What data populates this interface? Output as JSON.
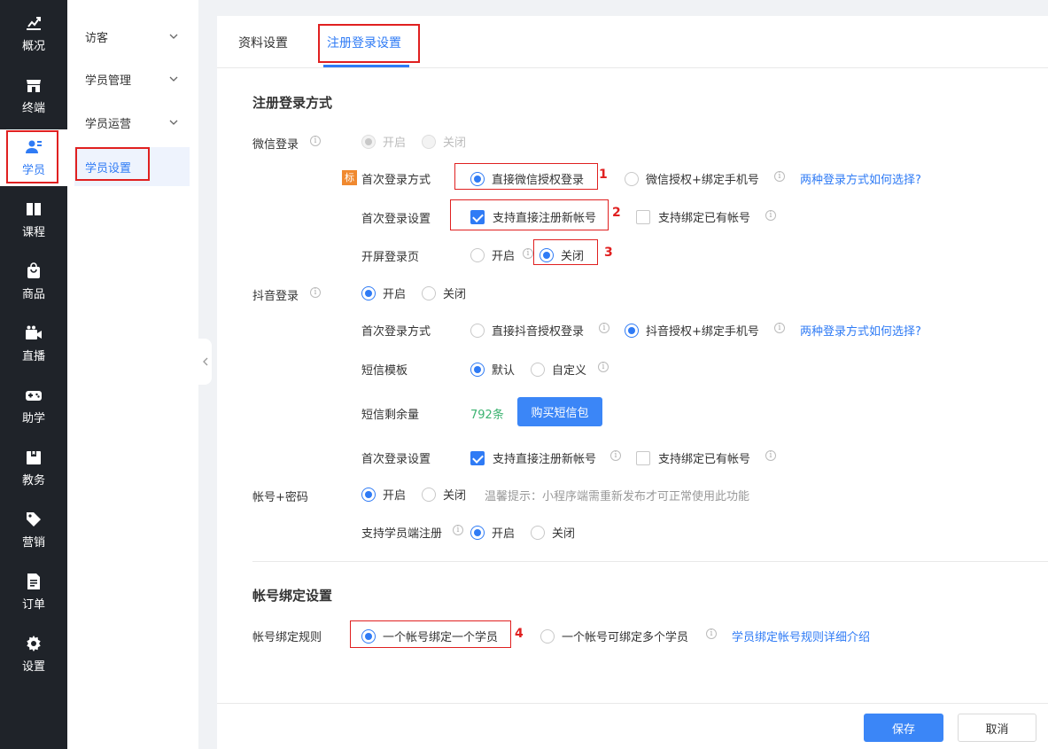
{
  "sidebar": {
    "items": [
      {
        "label": "概况",
        "icon": "chart-icon"
      },
      {
        "label": "终端",
        "icon": "store-icon"
      },
      {
        "label": "学员",
        "icon": "users-icon"
      },
      {
        "label": "课程",
        "icon": "book-icon"
      },
      {
        "label": "商品",
        "icon": "bag-icon"
      },
      {
        "label": "直播",
        "icon": "video-icon"
      },
      {
        "label": "助学",
        "icon": "gamepad-icon"
      },
      {
        "label": "教务",
        "icon": "calendar-icon"
      },
      {
        "label": "营销",
        "icon": "tag-icon"
      },
      {
        "label": "订单",
        "icon": "document-icon"
      },
      {
        "label": "设置",
        "icon": "gear-icon"
      }
    ],
    "active_color": "#2f7bf5"
  },
  "subnav": {
    "items": [
      {
        "label": "访客"
      },
      {
        "label": "学员管理"
      },
      {
        "label": "学员运营"
      },
      {
        "label": "学员设置"
      }
    ]
  },
  "tabs": [
    {
      "label": "资料设置"
    },
    {
      "label": "注册登录设置"
    }
  ],
  "login": {
    "section_title": "注册登录方式",
    "wechat": {
      "label": "微信登录",
      "open": "开启",
      "close": "关闭",
      "badge": "标",
      "first_method_label": "首次登录方式",
      "first_method_opt1": "直接微信授权登录",
      "first_method_opt2": "微信授权+绑定手机号",
      "first_method_link": "两种登录方式如何选择?",
      "first_setting_label": "首次登录设置",
      "first_setting_opt1": "支持直接注册新帐号",
      "first_setting_opt2": "支持绑定已有帐号",
      "splash_label": "开屏登录页",
      "splash_open": "开启",
      "splash_close": "关闭"
    },
    "douyin": {
      "label": "抖音登录",
      "open": "开启",
      "close": "关闭",
      "first_method_label": "首次登录方式",
      "first_method_opt1": "直接抖音授权登录",
      "first_method_opt2": "抖音授权+绑定手机号",
      "first_method_link": "两种登录方式如何选择?",
      "sms_template_label": "短信模板",
      "sms_template_default": "默认",
      "sms_template_custom": "自定义",
      "sms_remaining_label": "短信剩余量",
      "sms_remaining_value": "792条",
      "buy_sms_button": "购买短信包",
      "first_setting_label": "首次登录设置",
      "first_setting_opt1": "支持直接注册新帐号",
      "first_setting_opt2": "支持绑定已有帐号"
    },
    "account": {
      "label": "帐号+密码",
      "open": "开启",
      "close": "关闭",
      "hint": "温馨提示：小程序端需重新发布才可正常使用此功能",
      "student_register_label": "支持学员端注册",
      "student_register_open": "开启",
      "student_register_close": "关闭"
    }
  },
  "binding": {
    "section_title": "帐号绑定设置",
    "rule_label": "帐号绑定规则",
    "opt1": "一个帐号绑定一个学员",
    "opt2": "一个帐号可绑定多个学员",
    "link": "学员绑定帐号规则详细介绍"
  },
  "annotations": [
    "1",
    "2",
    "3",
    "4"
  ],
  "footer": {
    "save_button": "保存",
    "cancel_button": "取消"
  },
  "colors": {
    "primary": "#2f7bf5",
    "highlight": "#e02020",
    "sidebar_bg": "#1f2329",
    "badge": "#f0892f",
    "sms_value": "#3cb371"
  }
}
